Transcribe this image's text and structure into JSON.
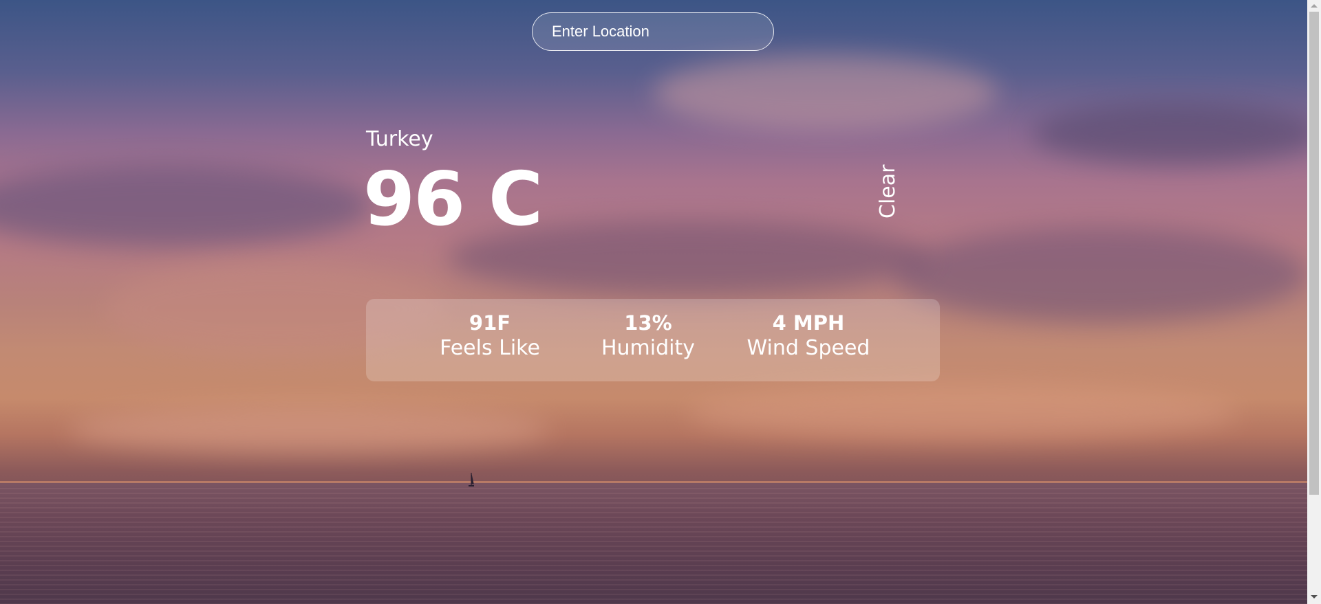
{
  "search": {
    "placeholder": "Enter Location"
  },
  "weather": {
    "location": "Turkey",
    "temperature": "96 C",
    "condition": "Clear"
  },
  "stats": [
    {
      "value": "91F",
      "label": "Feels Like"
    },
    {
      "value": "13%",
      "label": "Humidity"
    },
    {
      "value": "4 MPH",
      "label": "Wind Speed"
    }
  ],
  "colors": {
    "text": "#ffffff",
    "panel": "rgba(255,255,255,0.2)"
  }
}
